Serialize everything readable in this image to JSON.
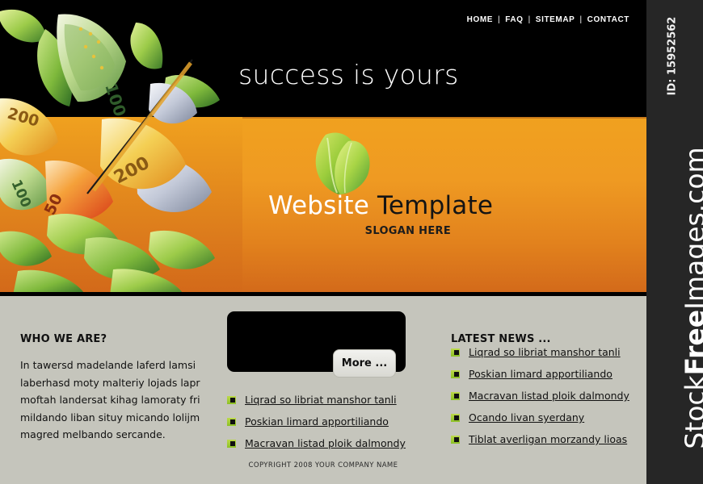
{
  "header": {
    "nav": [
      {
        "label": "HOME"
      },
      {
        "label": "FAQ"
      },
      {
        "label": "SITEMAP"
      },
      {
        "label": "CONTACT"
      }
    ],
    "separator": "|",
    "tagline": "success is yours"
  },
  "logo": {
    "title_light": "Website",
    "title_dark": " Template",
    "slogan": "SLOGAN HERE",
    "leaf_color_light": "#8ec73f",
    "leaf_color_dark": "#3f8b2e"
  },
  "colors": {
    "black": "#000000",
    "orange_top": "#f0a11f",
    "orange_bottom": "#d2681a",
    "content_grey": "#c5c5bc",
    "rail_grey": "#262626",
    "bullet_green": "#8cc024"
  },
  "content": {
    "left": {
      "title": "WHO WE ARE?",
      "body": "In tawersd madelande laferd lamsi laberhasd moty malteriy lojads lapr moftah landersat kihag lamoraty fri mildando liban situy micando lolijm magred melbando sercande."
    },
    "middle": {
      "more_label": "More ...",
      "items": [
        {
          "label": "Liqrad so libriat manshor tanli"
        },
        {
          "label": "Poskian limard apportiliando"
        },
        {
          "label": "Macravan listad ploik dalmondy"
        }
      ]
    },
    "right": {
      "title": "LATEST NEWS ...",
      "items": [
        {
          "label": "Liqrad so libriat manshor tanli"
        },
        {
          "label": "Poskian limard apportiliando"
        },
        {
          "label": "Macravan listad ploik dalmondy"
        },
        {
          "label": "Ocando livan syerdany"
        },
        {
          "label": "Tiblat averligan morzandy lioas"
        }
      ]
    }
  },
  "footer": {
    "copyright": "COPYRIGHT 2008 YOUR COMPANY NAME"
  },
  "watermark": {
    "id": "ID: 15952562",
    "brand_a": "Stock",
    "brand_b": "Free",
    "brand_c": "Images.com"
  },
  "artwork": {
    "description": "euro-banknotes-and-green-leaves-illustration",
    "notes": [
      "100",
      "200",
      "50"
    ]
  }
}
